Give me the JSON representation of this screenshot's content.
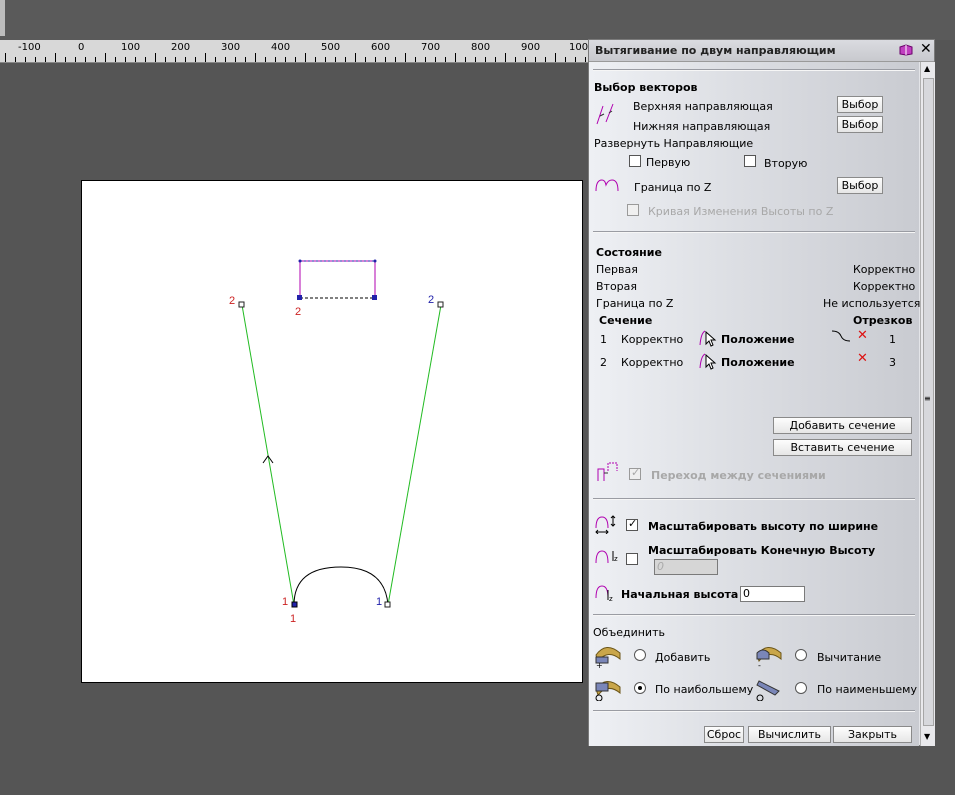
{
  "ruler": {
    "labels": [
      "-100",
      "0",
      "100",
      "200",
      "300",
      "400",
      "500",
      "600",
      "700",
      "800",
      "900",
      "100"
    ]
  },
  "canvas": {
    "node_labels": [
      "2",
      "2",
      "2",
      "1",
      "1",
      "1"
    ]
  },
  "dialog": {
    "title": "Вытягивание по двум направляющим",
    "vectors_heading": "Выбор векторов",
    "upper_rail": "Верхняя направляющая",
    "lower_rail": "Нижняя направляющая",
    "select_label": "Выбор",
    "flip_rails": "Развернуть Направляющие",
    "first": "Первую",
    "second": "Вторую",
    "z_boundary": "Граница по Z",
    "z_curve": "Кривая Изменения Высоты по Z",
    "state_heading": "Состояние",
    "state_rows": [
      {
        "name": "Первая",
        "value": "Корректно"
      },
      {
        "name": "Вторая",
        "value": "Корректно"
      },
      {
        "name": "Граница по Z",
        "value": "Не используется"
      }
    ],
    "section_header": "Сечение",
    "segments_header": "Отрезков",
    "sections": [
      {
        "num": "1",
        "status": "Корректно",
        "pos": "Положение",
        "segments": "1"
      },
      {
        "num": "2",
        "status": "Корректно",
        "pos": "Положение",
        "segments": "3"
      }
    ],
    "add_section": "Добавить сечение",
    "insert_section": "Вставить сечение",
    "transition": "Переход между сечениями",
    "scale_height_width": "Масштабировать высоту по ширине",
    "scale_end_height": "Масштабировать Конечную Высоту",
    "end_height_value": "0",
    "start_height": "Начальная высота",
    "start_height_value": "0",
    "combine": "Объединить",
    "add": "Добавить",
    "subtract": "Вычитание",
    "max": "По наибольшему",
    "min": "По наименьшему",
    "reset": "Сброс",
    "compute": "Вычислить",
    "close": "Закрыть"
  },
  "colors": {
    "rail": "#22bb22",
    "red_label": "#cc2222",
    "blue_label": "#2222aa",
    "accent": "#b000b0"
  }
}
